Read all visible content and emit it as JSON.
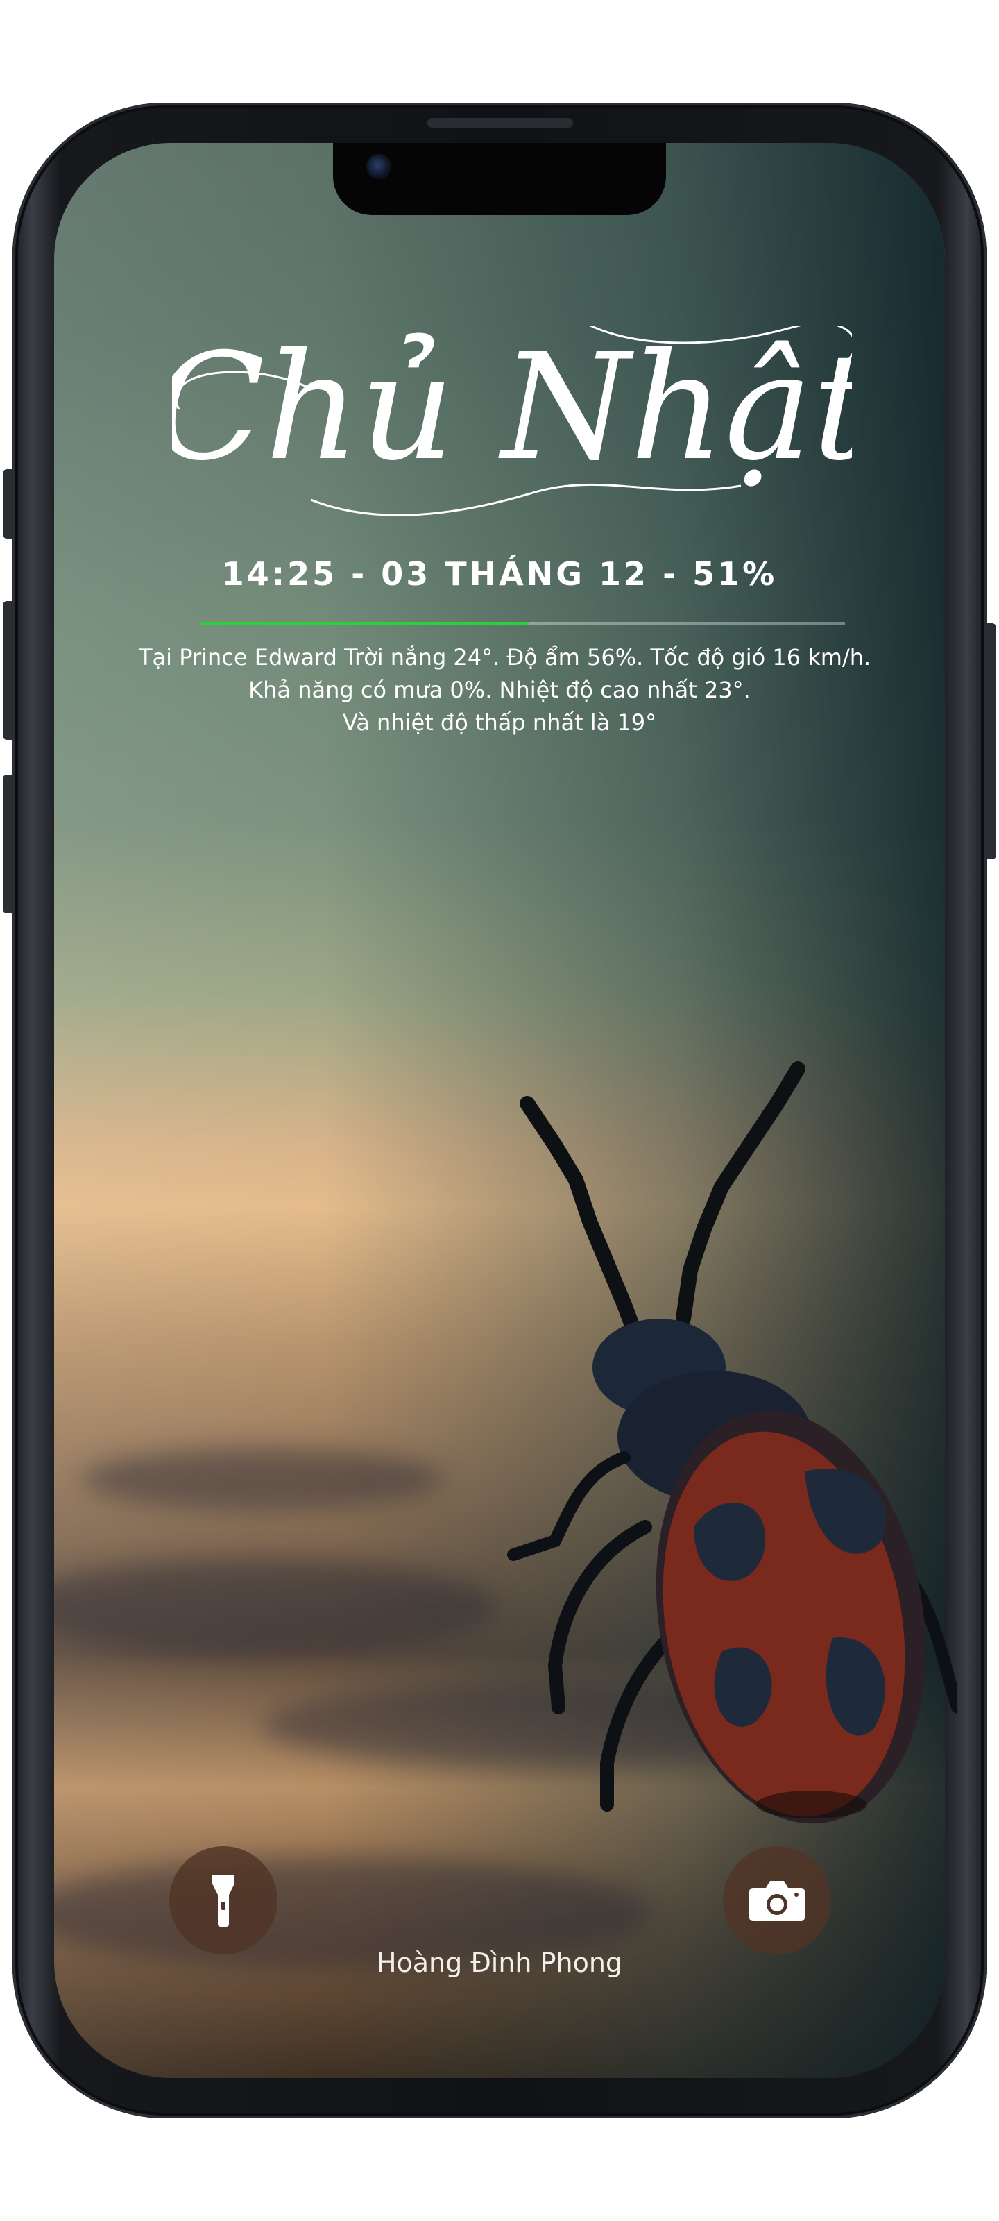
{
  "lock_screen": {
    "day": "Chủ Nhật",
    "status_line": "14:25 - 03 THÁNG 12 - 51%",
    "battery_percent": 51,
    "weather_lines": [
      "Tại Prince Edward Trời nắng 24°. Độ ẩm 56%. Tốc độ gió 16 km/h.",
      "Khả năng có mưa 0%. Nhiệt độ cao nhất 23°.",
      "Và nhiệt độ thấp nhất là 19°"
    ],
    "owner_name": "Hoàng Đình Phong"
  },
  "shortcuts": {
    "left_icon": "flashlight-icon",
    "right_icon": "camera-icon"
  },
  "colors": {
    "battery_bar": "#2ecf3a",
    "shortcut_bg": "#50342a",
    "text": "#ffffff"
  }
}
